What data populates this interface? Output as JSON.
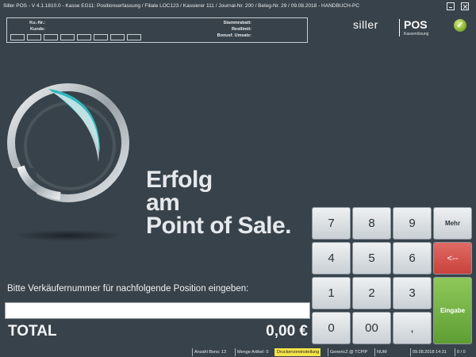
{
  "titlebar": {
    "text": "Siller POS - V 4.1.1810.0 - Kasse EG11: Positionserfassung / Filiale LOC123 / Kassierer 111 / Journal-Nr. 200 / Beleg-Nr. 29 / 09.08.2018  -  HANDBUCH-PC"
  },
  "info": {
    "ku_nr_label": "Ku.-Nr.:",
    "kunde_label": "Kunde:",
    "stammrabatt_label": "Stammrabatt:",
    "restlimit_label": "Restlimit:",
    "bonus_label": "Bonusf. Umsatz:"
  },
  "logo": {
    "siller": "siller",
    "pos": "POS",
    "subtitle": "Kassenlösung"
  },
  "slogan": {
    "line1": "Erfolg",
    "line2": "am",
    "line3": "Point of Sale."
  },
  "prompt": "Bitte Verkäufernummer für nachfolgende Position eingeben:",
  "input": {
    "value": ""
  },
  "total": {
    "label": "TOTAL",
    "value": "0,00 €"
  },
  "keypad": {
    "k7": "7",
    "k8": "8",
    "k9": "9",
    "more": "Mehr",
    "k4": "4",
    "k5": "5",
    "k6": "6",
    "back": "<--",
    "k1": "1",
    "k2": "2",
    "k3": "3",
    "enter": "Eingabe",
    "k0": "0",
    "k00": "00",
    "comma": ","
  },
  "statusbar": {
    "bons": "Anzahl Bons: 13",
    "artikel": "Menge Artikel: 0",
    "drucker": "Druckervoreinstellung",
    "generic": "GenericZ @ TCPIP",
    "num": "NUM",
    "datetime": "09.08.2018 14:31",
    "counter": "0 / 0"
  },
  "colors": {
    "background": "#38424a",
    "accent_teal": "#2fb8be",
    "back_key": "#d0504a",
    "enter_key": "#6aaa3c",
    "status_highlight": "#f4e34a"
  },
  "icons": {
    "minimize": "minimize-icon",
    "close": "close-icon",
    "status": "check-icon"
  }
}
